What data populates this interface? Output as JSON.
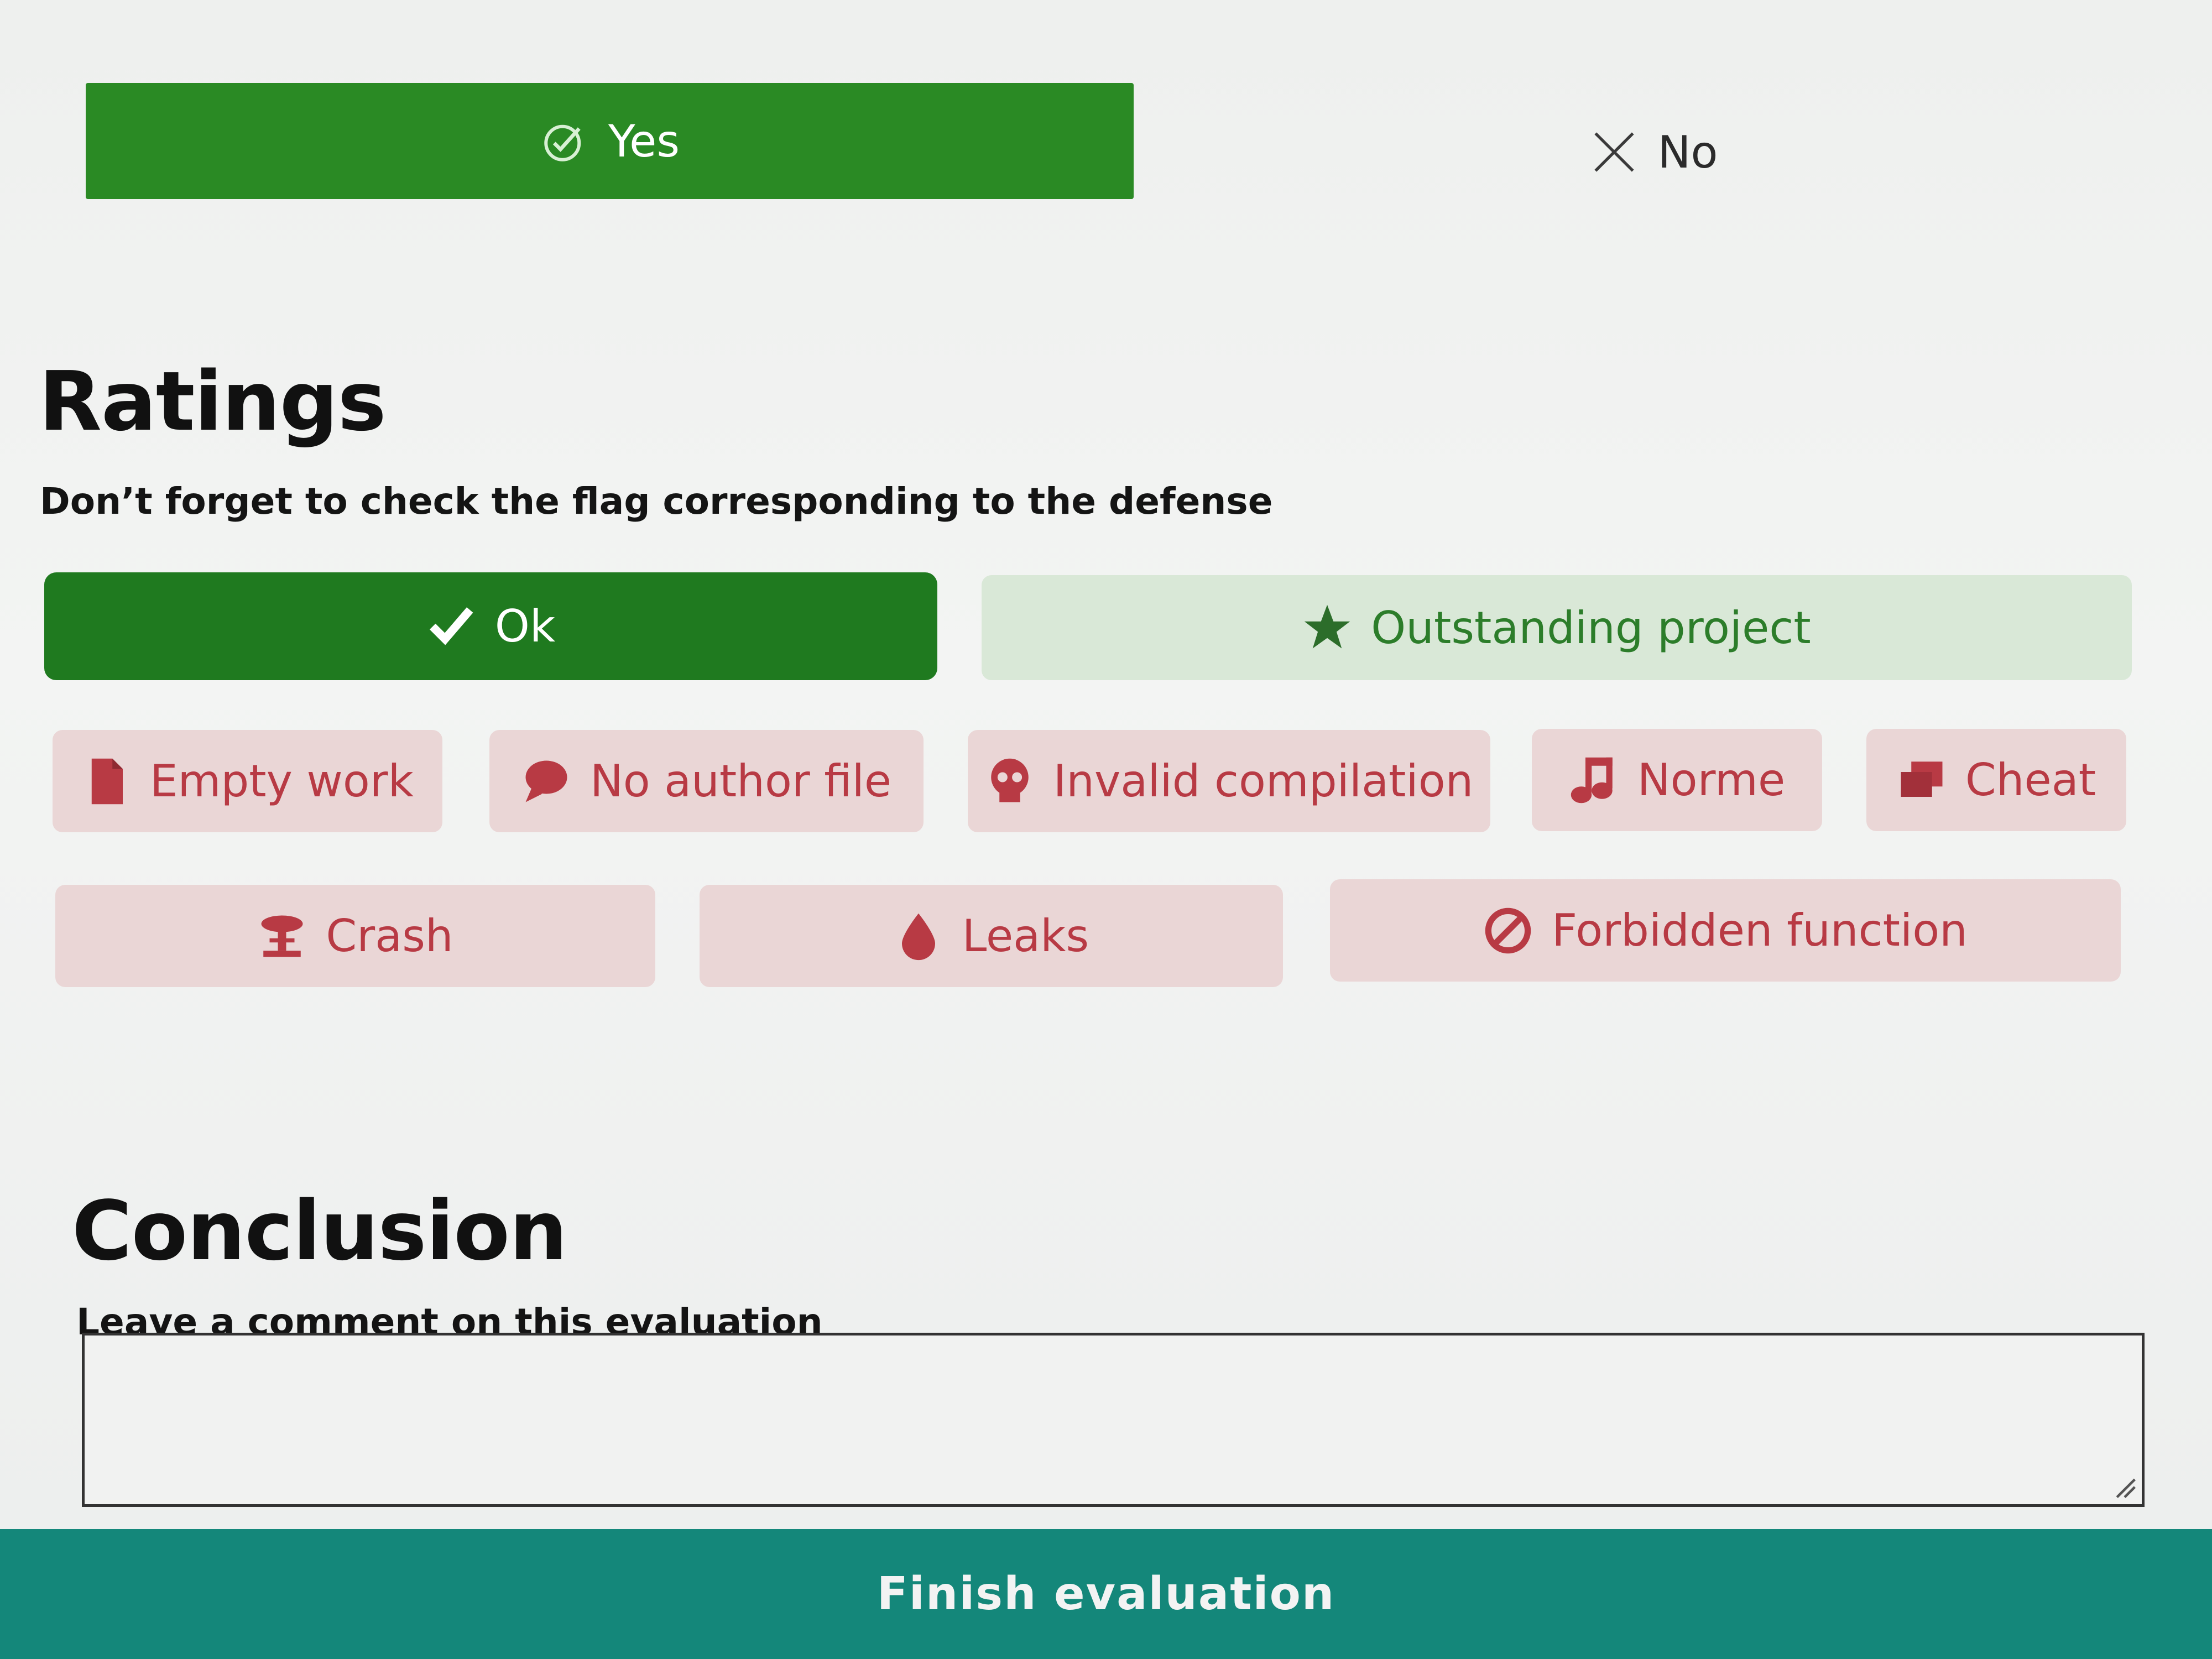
{
  "choice": {
    "yes_label": "Yes",
    "no_label": "No",
    "yes_icon": "check-circle-icon",
    "no_icon": "close-icon"
  },
  "ratings": {
    "title": "Ratings",
    "subtitle": "Don’t forget to check the flag corresponding to the defense",
    "ok_label": "Ok",
    "outstanding_label": "Outstanding project",
    "flags": [
      {
        "label": "Empty work",
        "icon": "file-icon"
      },
      {
        "label": "No author file",
        "icon": "comment-icon"
      },
      {
        "label": "Invalid compilation",
        "icon": "skull-icon"
      },
      {
        "label": "Norme",
        "icon": "music-icon"
      },
      {
        "label": "Cheat",
        "icon": "copy-icon"
      },
      {
        "label": "Crash",
        "icon": "explosion-icon"
      },
      {
        "label": "Leaks",
        "icon": "drop-icon"
      },
      {
        "label": "Forbidden function",
        "icon": "ban-icon"
      }
    ]
  },
  "conclusion": {
    "title": "Conclusion",
    "subtitle": "Leave a comment on this evaluation",
    "comment_value": ""
  },
  "finish_label": "Finish evaluation",
  "colors": {
    "green": "#2a8a24",
    "dark_green": "#1f7a1f",
    "flag_bg": "#ead6d6",
    "flag_text": "#b83a44",
    "teal": "#14877a"
  }
}
